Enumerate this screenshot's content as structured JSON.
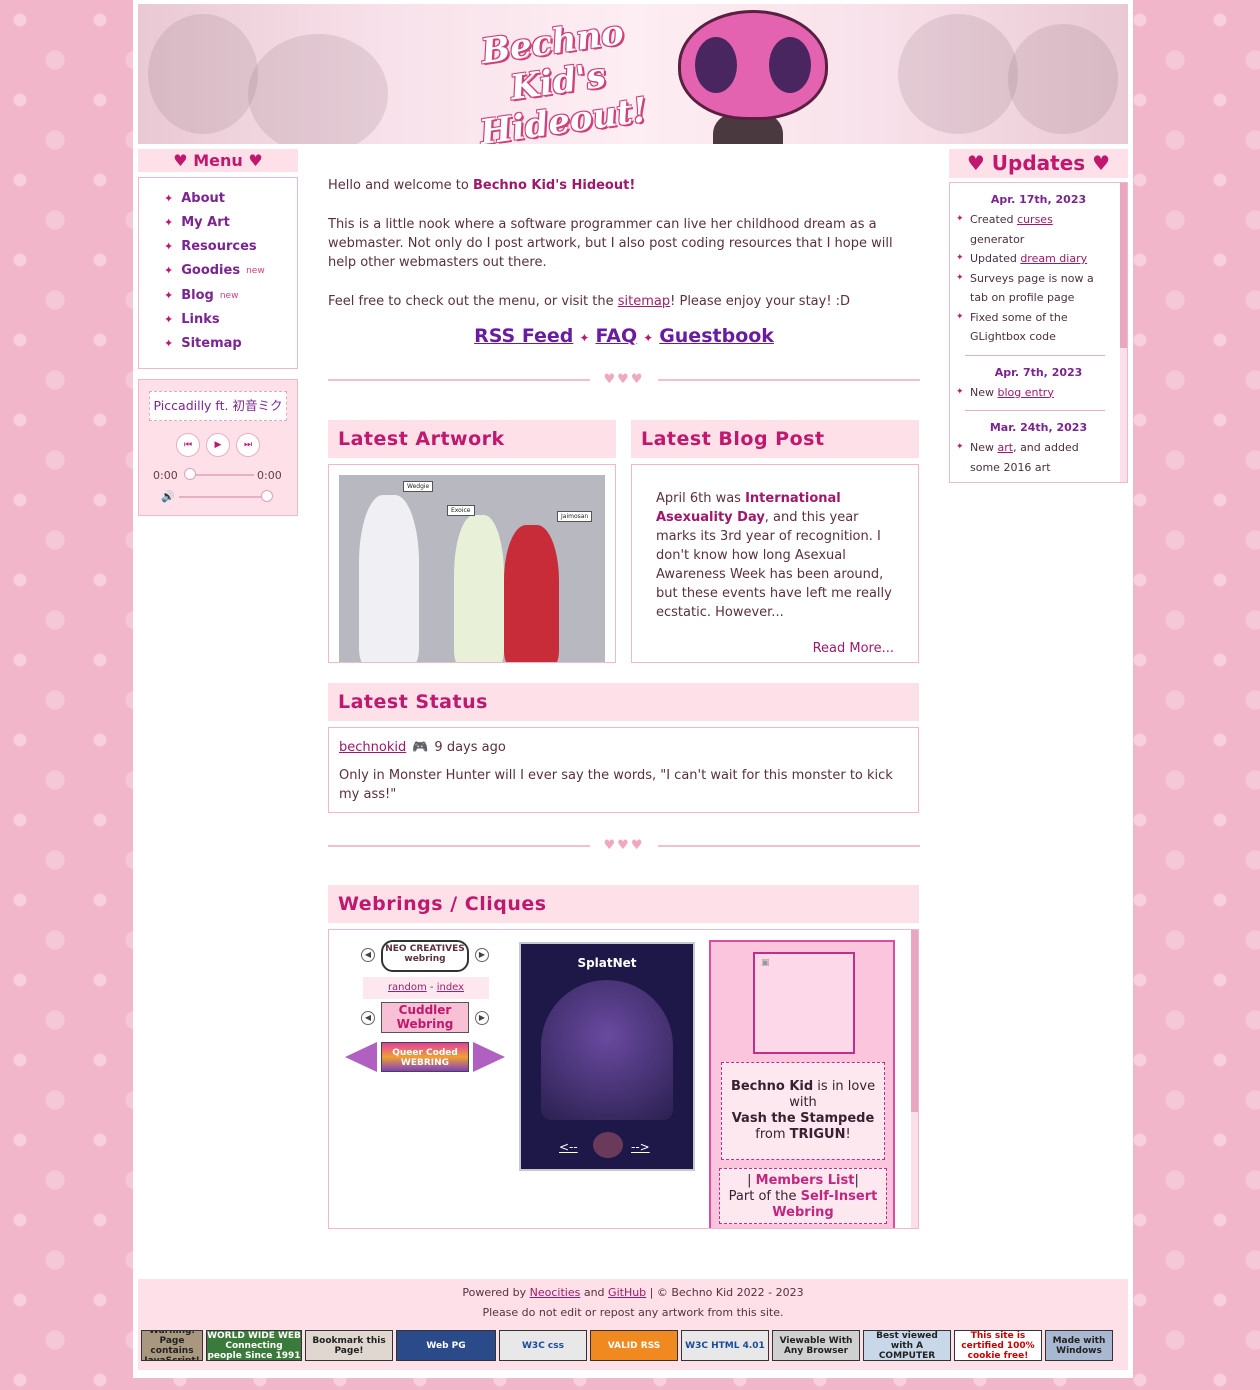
{
  "banner": {
    "title": "Bechno Kid's Hideout!"
  },
  "menu": {
    "heading": "♥ Menu ♥",
    "items": [
      {
        "label": "About",
        "new": ""
      },
      {
        "label": "My Art",
        "new": ""
      },
      {
        "label": "Resources",
        "new": ""
      },
      {
        "label": "Goodies",
        "new": "new"
      },
      {
        "label": "Blog",
        "new": "new"
      },
      {
        "label": "Links",
        "new": ""
      },
      {
        "label": "Sitemap",
        "new": ""
      }
    ]
  },
  "player": {
    "track": "Piccadilly ft. 初音ミク",
    "current_time": "0:00",
    "duration": "0:00",
    "progress": 0,
    "volume": 1
  },
  "intro": {
    "greeting_pre": "Hello and welcome to ",
    "greeting_bold": "Bechno Kid's Hideout!",
    "paragraph": "This is a little nook where a software programmer can live her childhood dream as a webmaster. Not only do I post artwork, but I also post coding resources that I hope will help other webmasters out there.",
    "cta_pre": "Feel free to check out the menu, or visit the ",
    "cta_link": "sitemap",
    "cta_post": "! Please enjoy your stay! :D"
  },
  "quicklinks": [
    "RSS Feed",
    "FAQ",
    "Guestbook"
  ],
  "divider_hearts": "♥♥♥",
  "latest_artwork": {
    "heading": "Latest Artwork",
    "tags": [
      "Wedgie",
      "Exoice",
      "Jaimosan"
    ]
  },
  "latest_blog": {
    "heading": "Latest Blog Post",
    "text_pre": "April 6th was ",
    "text_bold": "International Asexuality Day",
    "text_post": ", and this year marks its 3rd year of recognition. I don't know how long Asexual Awareness Week has been around, but these events have left me really ecstatic. However...",
    "read_more": "Read More..."
  },
  "latest_status": {
    "heading": "Latest Status",
    "user": "bechnokid",
    "emoji": "🎮",
    "time": "9 days ago",
    "message": "Only in Monster Hunter will I ever say the words, \"I can't wait for this monster to kick my ass!\""
  },
  "webrings": {
    "heading": "Webrings / Cliques",
    "neo_creatives": "NEO CREATIVES webring",
    "random": "random",
    "index": "index",
    "cuddler": "Cuddler Webring",
    "queer_coded": "Queer Coded WEBRING",
    "splatnet": {
      "title": "SplatNet",
      "prev": "<--",
      "next": "-->"
    },
    "selfinsert": {
      "user": "Bechno Kid",
      "mid": " is in love with",
      "char": "Vash the Stampede",
      "from": "from ",
      "series": "TRIGUN",
      "bang": "!",
      "members": "Members List",
      "part_of": "Part of the ",
      "ring": "Self-Insert Webring"
    }
  },
  "updates": {
    "heading": "♥ Updates ♥",
    "entries": [
      {
        "date": "Apr. 17th, 2023",
        "items": [
          {
            "pre": "Created ",
            "link": "curses",
            "post": " generator"
          },
          {
            "pre": "Updated ",
            "link": "dream diary",
            "post": ""
          },
          {
            "pre": "Surveys page is now a tab on profile page",
            "link": "",
            "post": ""
          },
          {
            "pre": "Fixed some of the GLightbox code",
            "link": "",
            "post": ""
          }
        ]
      },
      {
        "date": "Apr. 7th, 2023",
        "items": [
          {
            "pre": "New ",
            "link": "blog entry",
            "post": ""
          }
        ]
      },
      {
        "date": "Mar. 24th, 2023",
        "items": [
          {
            "pre": "New ",
            "link": "art",
            "post": ", and added some 2016 art"
          }
        ]
      }
    ]
  },
  "footer": {
    "powered_pre": "Powered by ",
    "neocities": "Neocities",
    "and": " and ",
    "github": "GitHub",
    "copyright": " | © Bechno Kid 2022 - 2023",
    "notice": "Please do not edit or repost any artwork from this site.",
    "badges": [
      "Warning: Page contains JavaScript!",
      "WORLD WIDE WEB Connecting people Since 1991",
      "Bookmark this Page!",
      "Web PG",
      "W3C css",
      "VALID RSS",
      "W3C HTML 4.01",
      "Viewable With Any Browser",
      "Best viewed with A COMPUTER",
      "This site is certified 100% cookie free!",
      "Made with Windows"
    ]
  },
  "colors": {
    "accent": "#c0186e",
    "link": "#a0186a",
    "menu_text": "#7a2590",
    "panel_bg": "#fde0e8",
    "page_bg": "#f2b6cb"
  }
}
